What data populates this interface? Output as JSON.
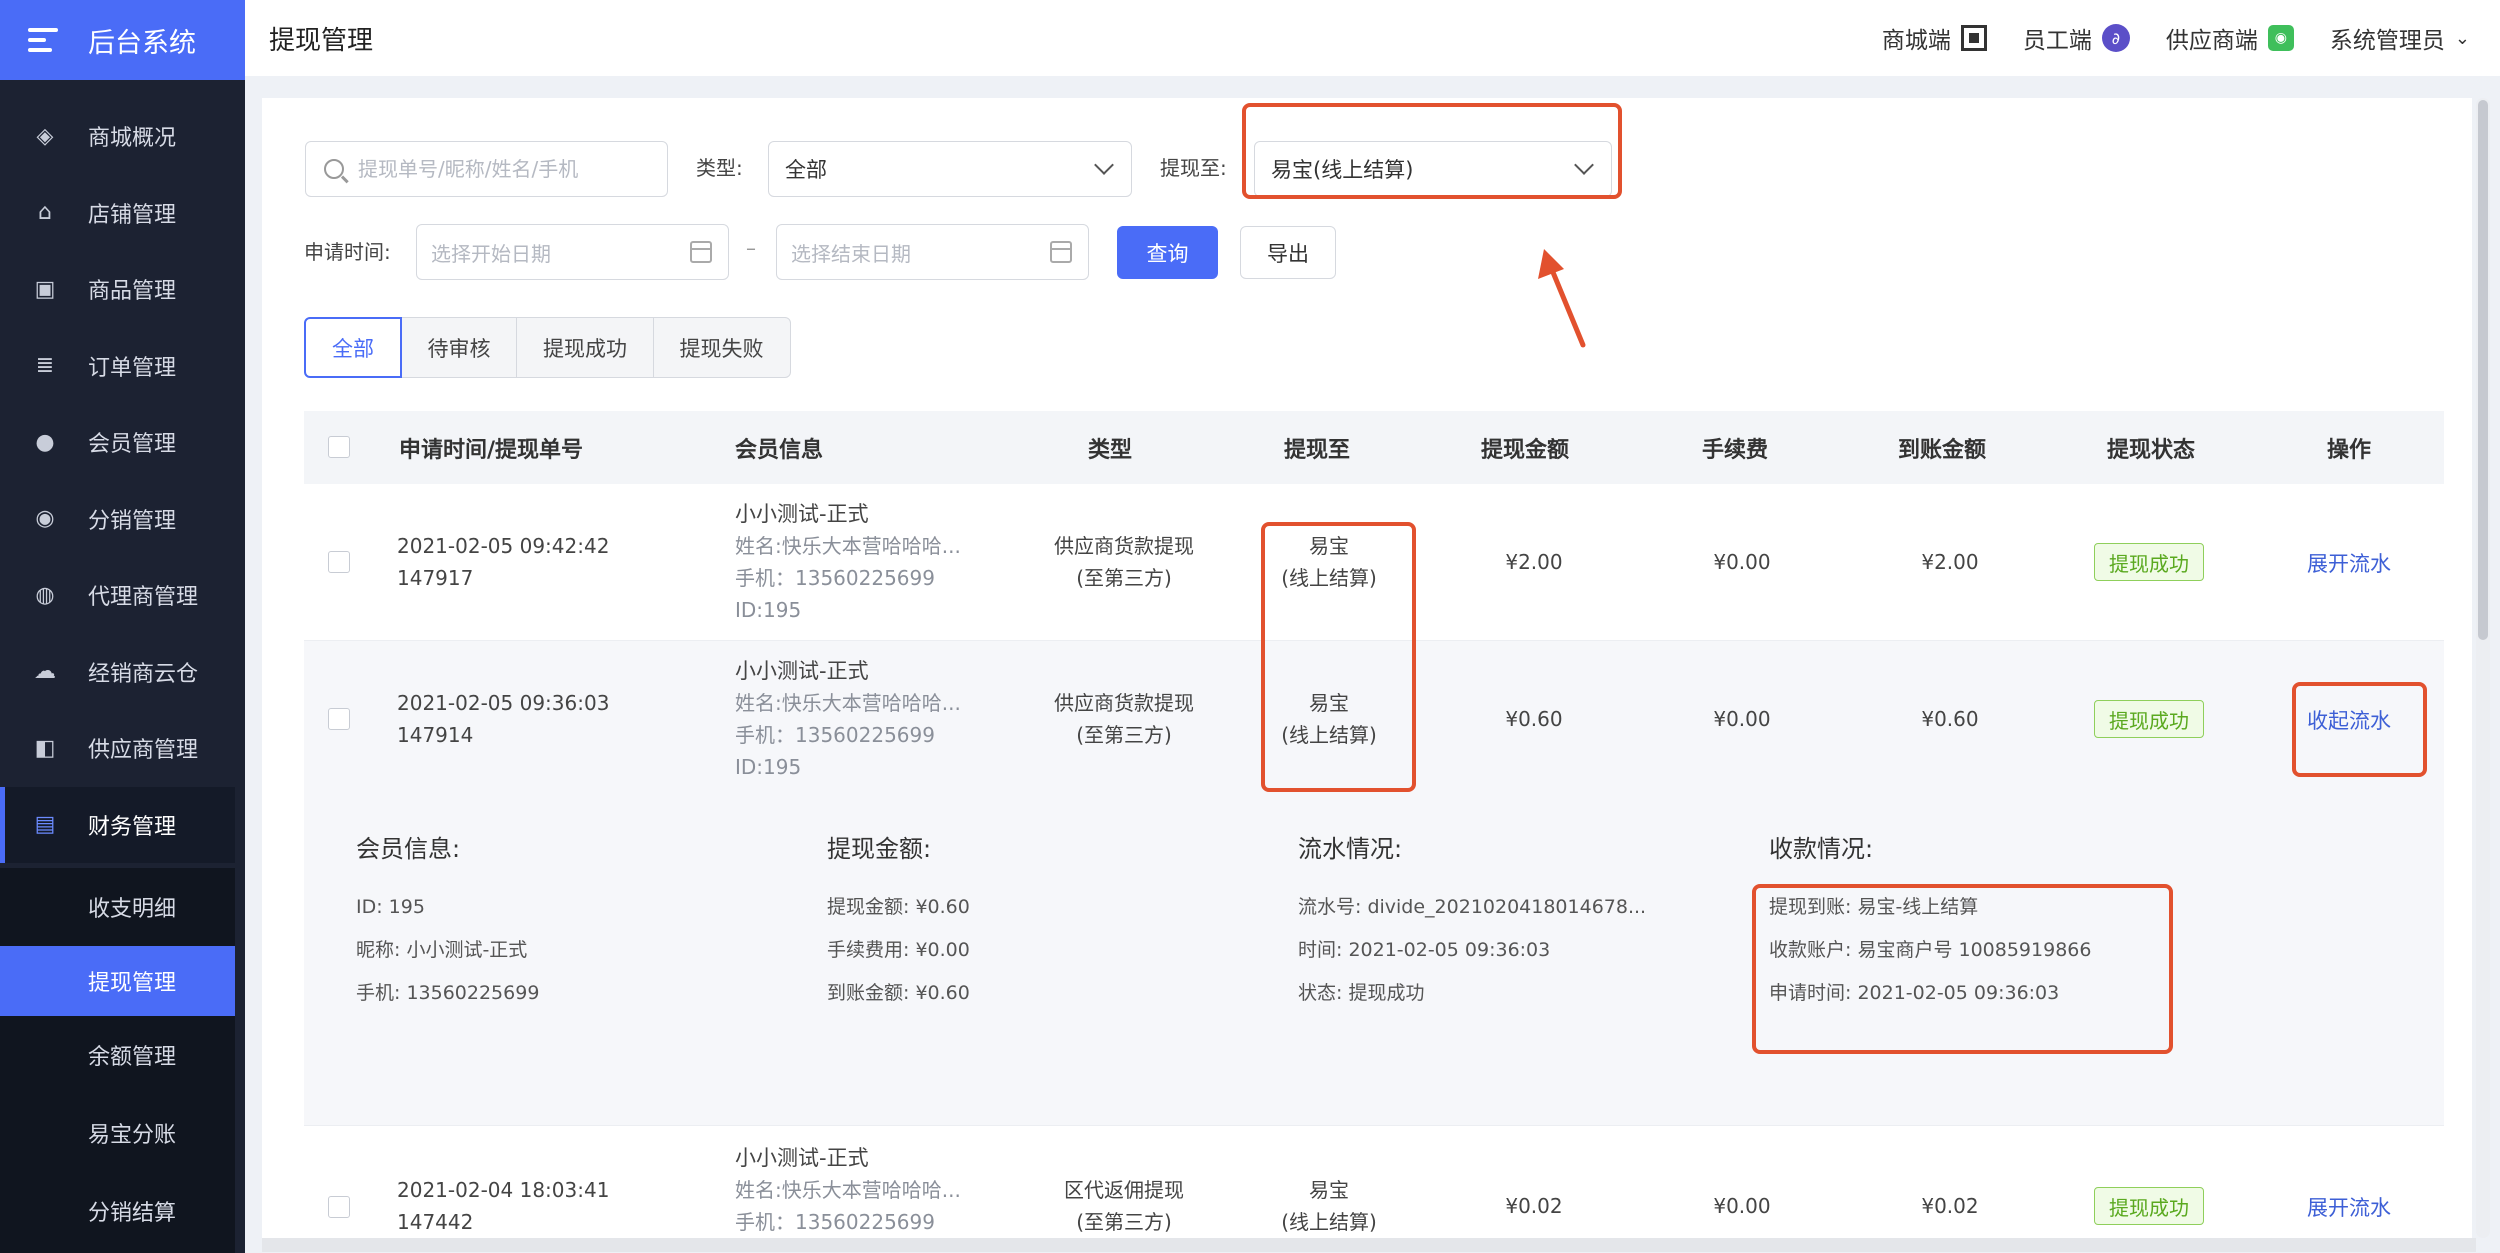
{
  "app": {
    "title": "后台系统"
  },
  "sidebar": {
    "items": [
      {
        "label": "商城概况",
        "icon": "layers-icon",
        "glyph": "◈"
      },
      {
        "label": "店铺管理",
        "icon": "basket-icon",
        "glyph": "⌂"
      },
      {
        "label": "商品管理",
        "icon": "cube-icon",
        "glyph": "▣"
      },
      {
        "label": "订单管理",
        "icon": "document-icon",
        "glyph": "≣"
      },
      {
        "label": "会员管理",
        "icon": "user-icon",
        "glyph": "●"
      },
      {
        "label": "分销管理",
        "icon": "user-share-icon",
        "glyph": "◉"
      },
      {
        "label": "代理商管理",
        "icon": "users-icon",
        "glyph": "◍"
      },
      {
        "label": "经销商云仓",
        "icon": "cloud-icon",
        "glyph": "☁"
      },
      {
        "label": "供应商管理",
        "icon": "supplier-icon",
        "glyph": "◧"
      },
      {
        "label": "财务管理",
        "icon": "wallet-icon",
        "glyph": "▤"
      }
    ],
    "submenu": [
      "收支明细",
      "提现管理",
      "余额管理",
      "易宝分账",
      "分销结算"
    ]
  },
  "header": {
    "page_title": "提现管理",
    "links": [
      "商城端",
      "员工端",
      "供应商端"
    ],
    "user": "系统管理员"
  },
  "filters": {
    "search_placeholder": "提现单号/昵称/姓名/手机",
    "type_label": "类型:",
    "type_value": "全部",
    "withdraw_to_label": "提现至:",
    "withdraw_to_value": "易宝(线上结算)",
    "apply_time_label": "申请时间:",
    "start_placeholder": "选择开始日期",
    "dash": "–",
    "end_placeholder": "选择结束日期",
    "query_button": "查询",
    "export_button": "导出"
  },
  "tabs": [
    "全部",
    "待审核",
    "提现成功",
    "提现失败"
  ],
  "table": {
    "headers": [
      "申请时间/提现单号",
      "会员信息",
      "类型",
      "提现至",
      "提现金额",
      "手续费",
      "到账金额",
      "提现状态",
      "操作"
    ],
    "rows": [
      {
        "time": "2021-02-05 09:42:42",
        "order": "147917",
        "member_name": "小小测试-正式",
        "member_real": "姓名:快乐大本营哈哈哈...",
        "member_phone": "手机：13560225699",
        "member_id": "ID:195",
        "type_1": "供应商货款提现",
        "type_2": "(至第三方)",
        "to_1": "易宝",
        "to_2": "(线上结算)",
        "amount": "¥2.00",
        "fee": "¥0.00",
        "received": "¥2.00",
        "status": "提现成功",
        "action": "展开流水"
      },
      {
        "time": "2021-02-05 09:36:03",
        "order": "147914",
        "member_name": "小小测试-正式",
        "member_real": "姓名:快乐大本营哈哈哈...",
        "member_phone": "手机：13560225699",
        "member_id": "ID:195",
        "type_1": "供应商货款提现",
        "type_2": "(至第三方)",
        "to_1": "易宝",
        "to_2": "(线上结算)",
        "amount": "¥0.60",
        "fee": "¥0.00",
        "received": "¥0.60",
        "status": "提现成功",
        "action": "收起流水"
      },
      {
        "time": "2021-02-04 18:03:41",
        "order": "147442",
        "member_name": "小小测试-正式",
        "member_real": "姓名:快乐大本营哈哈哈...",
        "member_phone": "手机：13560225699",
        "type_1": "区代返佣提现",
        "type_2": "(至第三方)",
        "to_1": "易宝",
        "to_2": "(线上结算)",
        "amount": "¥0.02",
        "fee": "¥0.00",
        "received": "¥0.02",
        "status": "提现成功",
        "action": "展开流水"
      }
    ]
  },
  "detail": {
    "member": {
      "title": "会员信息:",
      "id": "ID:  195",
      "nickname": "昵称:  小小测试-正式",
      "phone": "手机:  13560225699"
    },
    "amount": {
      "title": "提现金额:",
      "amount": "提现金额:  ¥0.60",
      "fee": "手续费用:  ¥0.00",
      "received": "到账金额:  ¥0.60"
    },
    "flow": {
      "title": "流水情况:",
      "no": "流水号:  divide_2021020418014678...",
      "time": "时间:  2021-02-05 09:36:03",
      "status": "状态:  提现成功"
    },
    "receipt": {
      "title": "收款情况:",
      "to": "提现到账:  易宝-线上结算",
      "account": "收款账户:  易宝商户号 10085919866",
      "apply_time": "申请时间:  2021-02-05 09:36:03"
    }
  },
  "colors": {
    "primary": "#4a6cf7",
    "sidebar": "#1c2232",
    "annotation": "#e2512e",
    "success": "#5aa91f"
  }
}
